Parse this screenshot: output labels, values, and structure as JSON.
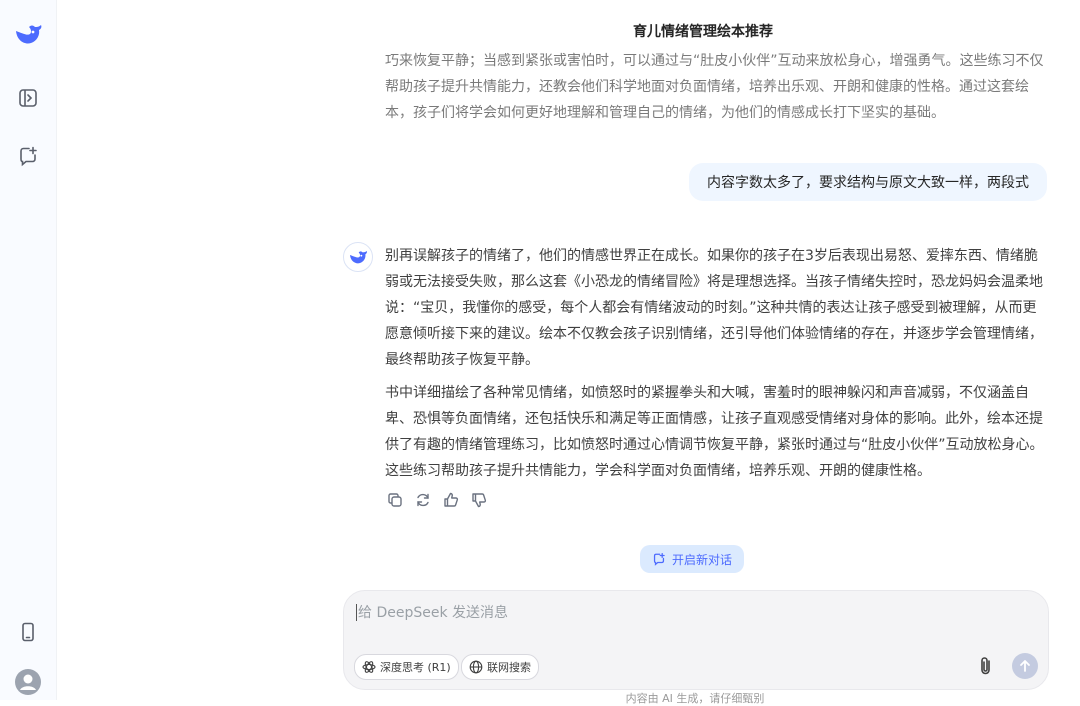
{
  "header": {
    "title": "育儿情绪管理绘本推荐"
  },
  "messages": {
    "previous_tail": "巧来恢复平静；当感到紧张或害怕时，可以通过与“肚皮小伙伴”互动来放松身心，增强勇气。这些练习不仅帮助孩子提升共情能力，还教会他们科学地面对负面情绪，培养出乐观、开朗和健康的性格。通过这套绘本，孩子们将学会如何更好地理解和管理自己的情绪，为他们的情感成长打下坚实的基础。",
    "user": "内容字数太多了，要求结构与原文大致一样，两段式",
    "assistant_p1": "别再误解孩子的情绪了，他们的情感世界正在成长。如果你的孩子在3岁后表现出易怒、爱摔东西、情绪脆弱或无法接受失败，那么这套《小恐龙的情绪冒险》将是理想选择。当孩子情绪失控时，恐龙妈妈会温柔地说：“宝贝，我懂你的感受，每个人都会有情绪波动的时刻。”这种共情的表达让孩子感受到被理解，从而更愿意倾听接下来的建议。绘本不仅教会孩子识别情绪，还引导他们体验情绪的存在，并逐步学会管理情绪，最终帮助孩子恢复平静。",
    "assistant_p2": "书中详细描绘了各种常见情绪，如愤怒时的紧握拳头和大喊，害羞时的眼神躲闪和声音减弱，不仅涵盖自卑、恐惧等负面情绪，还包括快乐和满足等正面情感，让孩子直观感受情绪对身体的影响。此外，绘本还提供了有趣的情绪管理练习，比如愤怒时通过心情调节恢复平静，紧张时通过与“肚皮小伙伴”互动放松身心。这些练习帮助孩子提升共情能力，学会科学面对负面情绪，培养乐观、开朗的健康性格。"
  },
  "new_chat": {
    "label": "开启新对话"
  },
  "composer": {
    "placeholder": "给 DeepSeek 发送消息",
    "deep_think_label": "深度思考 (R1)",
    "web_search_label": "联网搜索"
  },
  "disclaimer": "内容由 AI 生成，请仔细甄别",
  "colors": {
    "brand": "#4d6bfe",
    "bubble": "#eff6ff",
    "new_chat_bg": "#dbeafe"
  }
}
